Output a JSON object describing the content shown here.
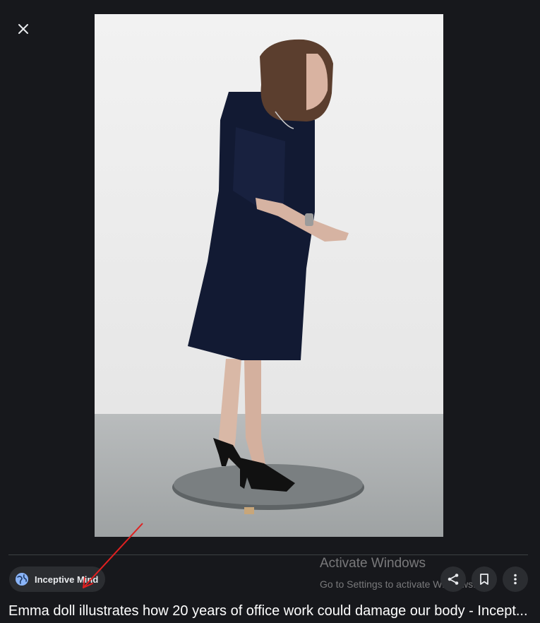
{
  "viewer": {
    "close_label": "Close",
    "source_name": "Inceptive Mind",
    "caption": "Emma doll illustrates how 20 years of office work could damage our body - Incept..."
  },
  "watermark": {
    "title": "Activate Windows",
    "subtitle": "Go to Settings to activate Windows."
  },
  "icons": {
    "close": "close-icon",
    "source": "globe-icon",
    "share": "share-icon",
    "save": "bookmark-icon",
    "more": "more-vertical-icon"
  },
  "colors": {
    "background": "#17181c",
    "chip": "#2b2d31",
    "arrow": "#e02020"
  }
}
